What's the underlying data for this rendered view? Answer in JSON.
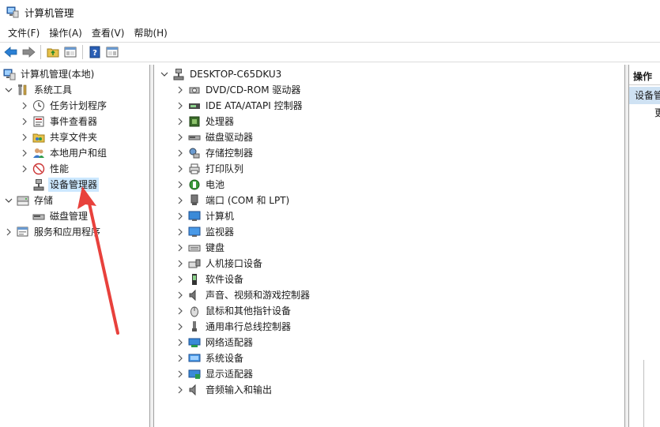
{
  "window": {
    "title": "计算机管理"
  },
  "menu": [
    "文件(F)",
    "操作(A)",
    "查看(V)",
    "帮助(H)"
  ],
  "toolbar": {
    "buttons": [
      "back-icon",
      "forward-icon",
      "up-folder-icon",
      "show-hide-tree-icon",
      "help-icon",
      "properties-icon"
    ]
  },
  "left_tree": {
    "root": "计算机管理(本地)",
    "system_tools": "系统工具",
    "task_scheduler": "任务计划程序",
    "event_viewer": "事件查看器",
    "shared_folders": "共享文件夹",
    "local_users": "本地用户和组",
    "performance": "性能",
    "device_manager": "设备管理器",
    "storage": "存储",
    "disk_management": "磁盘管理",
    "services_apps": "服务和应用程序"
  },
  "device_tree": {
    "computer": "DESKTOP-C65DKU3",
    "categories": [
      "DVD/CD-ROM 驱动器",
      "IDE ATA/ATAPI 控制器",
      "处理器",
      "磁盘驱动器",
      "存储控制器",
      "打印队列",
      "电池",
      "端口 (COM 和 LPT)",
      "计算机",
      "监视器",
      "键盘",
      "人机接口设备",
      "软件设备",
      "声音、视频和游戏控制器",
      "鼠标和其他指针设备",
      "通用串行总线控制器",
      "网络适配器",
      "系统设备",
      "显示适配器",
      "音频输入和输出"
    ]
  },
  "actions_pane": {
    "header": "操作",
    "section": "设备管理器",
    "more": "更"
  },
  "colors": {
    "selection": "#cce8ff",
    "annotation_arrow": "#e8413c"
  }
}
